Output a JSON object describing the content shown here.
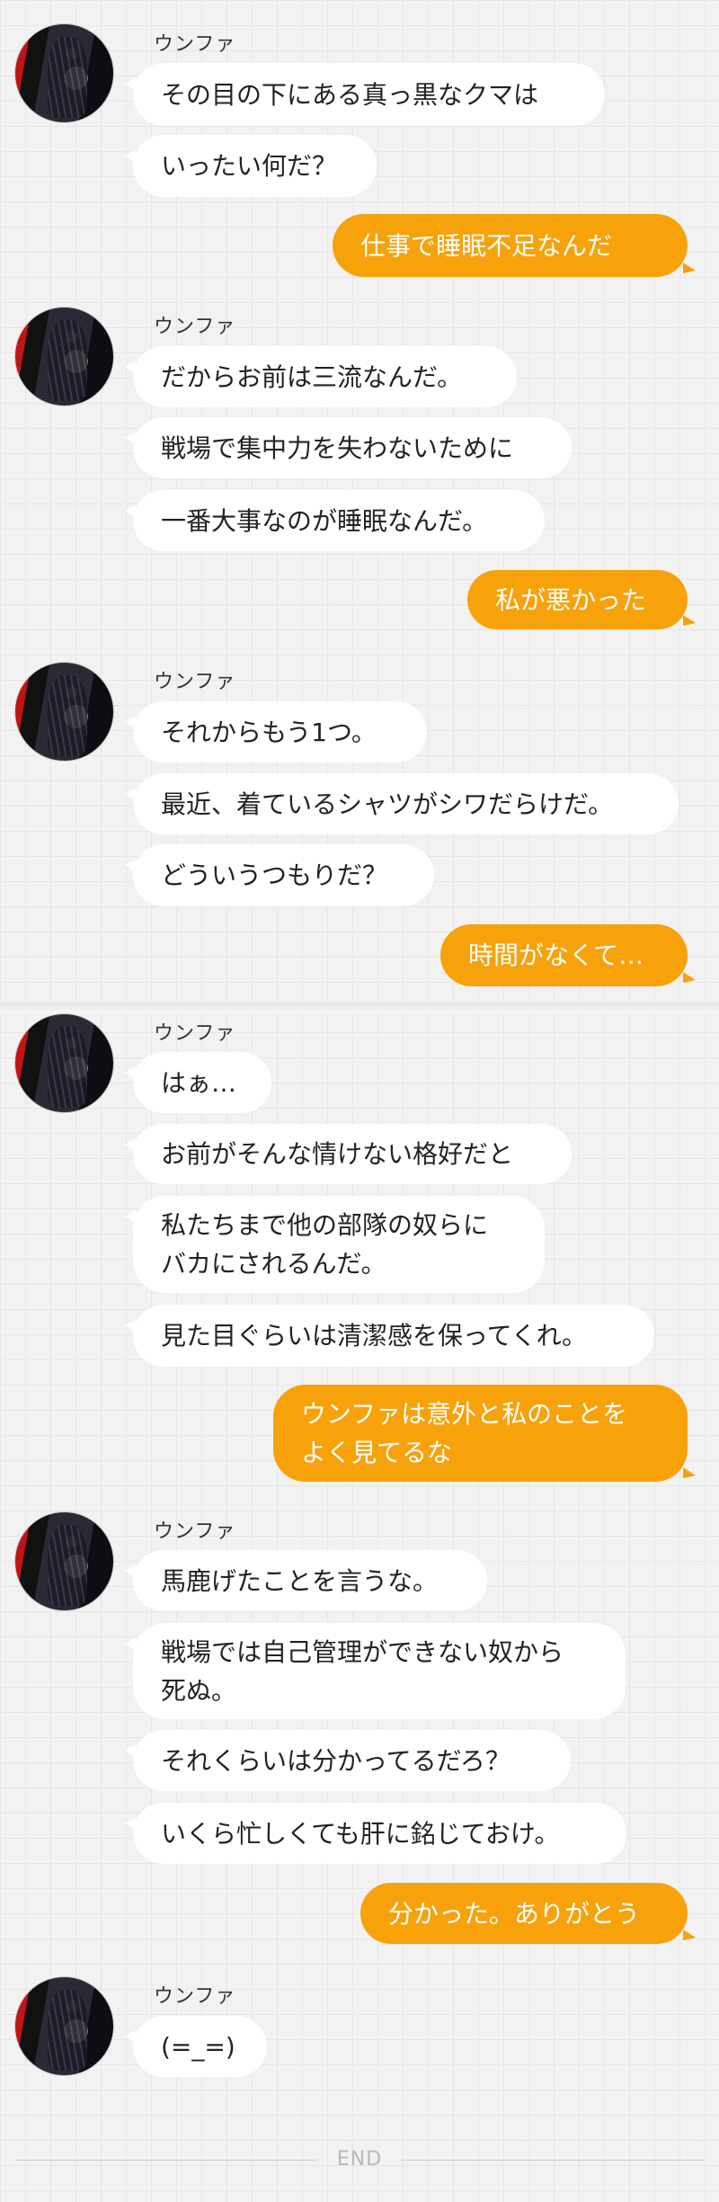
{
  "conversation": [
    {
      "side": "left",
      "sender": "ウンファ",
      "lines": [
        "その目の下にある真っ黒なクマは",
        "いったい何だ？"
      ]
    },
    {
      "side": "right",
      "lines": [
        "仕事で睡眠不足なんだ"
      ]
    },
    {
      "side": "left",
      "sender": "ウンファ",
      "lines": [
        "だからお前は三流なんだ。",
        "戦場で集中力を失わないために",
        "一番大事なのが睡眠なんだ。"
      ]
    },
    {
      "side": "right",
      "lines": [
        "私が悪かった"
      ]
    },
    {
      "side": "left",
      "sender": "ウンファ",
      "lines": [
        "それからもう1つ。",
        "最近、着ているシャツがシワだらけだ。",
        "どういうつもりだ？"
      ]
    },
    {
      "side": "right",
      "lines": [
        "時間がなくて…"
      ]
    },
    {
      "side": "left",
      "sender": "ウンファ",
      "lines": [
        "はぁ…",
        "お前がそんな情けない格好だと",
        "私たちまで他の部隊の奴らに\nバカにされるんだ。",
        "見た目ぐらいは清潔感を保ってくれ。"
      ]
    },
    {
      "side": "right",
      "lines": [
        "ウンファは意外と私のことを\nよく見てるな"
      ]
    },
    {
      "side": "left",
      "sender": "ウンファ",
      "lines": [
        "馬鹿げたことを言うな。",
        "戦場では自己管理ができない奴から\n死ぬ。",
        "それくらいは分かってるだろ？",
        "いくら忙しくても肝に銘じておけ。"
      ]
    },
    {
      "side": "right",
      "lines": [
        "分かった。ありがとう"
      ]
    },
    {
      "side": "left",
      "sender": "ウンファ",
      "lines": [
        "(=_=)"
      ]
    }
  ],
  "footer": {
    "end_label": "END"
  },
  "colors": {
    "outgoing_bubble": "#f7a20b",
    "incoming_bubble": "#ffffff",
    "background": "#f2f2f2"
  }
}
